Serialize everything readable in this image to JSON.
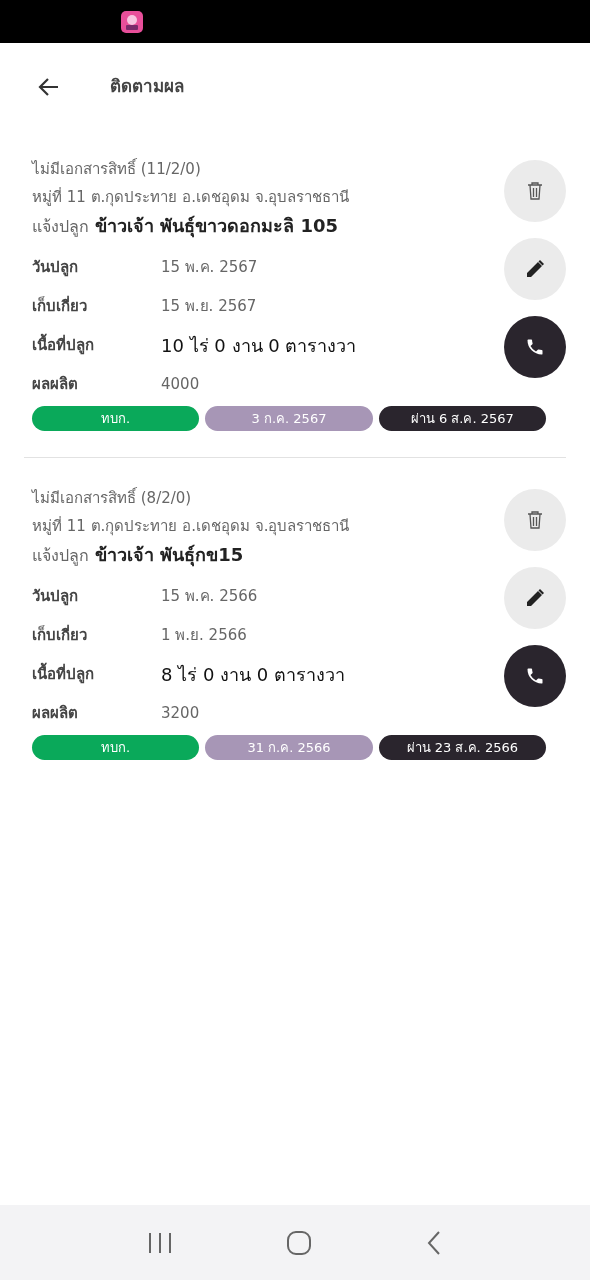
{
  "app_bar": {
    "title": "ติดตามผล"
  },
  "records": [
    {
      "title": "ไม่มีเอกสารสิทธิ์ (11/2/0)",
      "address": "หมู่ที่ 11 ต.กุดประทาย อ.เดชอุดม จ.อุบลราชธานี",
      "plant_label": "แจ้งปลูก",
      "plant_value": "ข้าวเจ้า พันธุ์ขาวดอกมะลิ 105",
      "fields": [
        {
          "label": "วันปลูก",
          "value": "15 พ.ค. 2567",
          "kind": "text"
        },
        {
          "label": "เก็บเกี่ยว",
          "value": "15 พ.ย. 2567",
          "kind": "text"
        },
        {
          "label": "เนื้อที่ปลูก",
          "value": "10 ไร่ 0 งาน 0 ตารางวา",
          "kind": "emphasis"
        },
        {
          "label": "ผลผลิต",
          "value": "4000",
          "kind": "text"
        }
      ],
      "tags": [
        {
          "text": "ทบก.",
          "color": "#0aa95a"
        },
        {
          "text": "3 ก.ค. 2567",
          "color": "#a796b6"
        },
        {
          "text": "ผ่าน 6 ส.ค. 2567",
          "color": "#2a252d"
        }
      ]
    },
    {
      "title": "ไม่มีเอกสารสิทธิ์ (8/2/0)",
      "address": "หมู่ที่ 11 ต.กุดประทาย อ.เดชอุดม จ.อุบลราชธานี",
      "plant_label": "แจ้งปลูก",
      "plant_value": "ข้าวเจ้า พันธุ์กข15",
      "fields": [
        {
          "label": "วันปลูก",
          "value": "15 พ.ค. 2566",
          "kind": "text"
        },
        {
          "label": "เก็บเกี่ยว",
          "value": "1 พ.ย. 2566",
          "kind": "text"
        },
        {
          "label": "เนื้อที่ปลูก",
          "value": "8 ไร่ 0 งาน 0 ตารางวา",
          "kind": "emphasis"
        },
        {
          "label": "ผลผลิต",
          "value": "3200",
          "kind": "text"
        }
      ],
      "tags": [
        {
          "text": "ทบก.",
          "color": "#0aa95a"
        },
        {
          "text": "31 ก.ค. 2566",
          "color": "#a796b6"
        },
        {
          "text": "ผ่าน 23 ส.ค. 2566",
          "color": "#2a252d"
        }
      ]
    }
  ]
}
